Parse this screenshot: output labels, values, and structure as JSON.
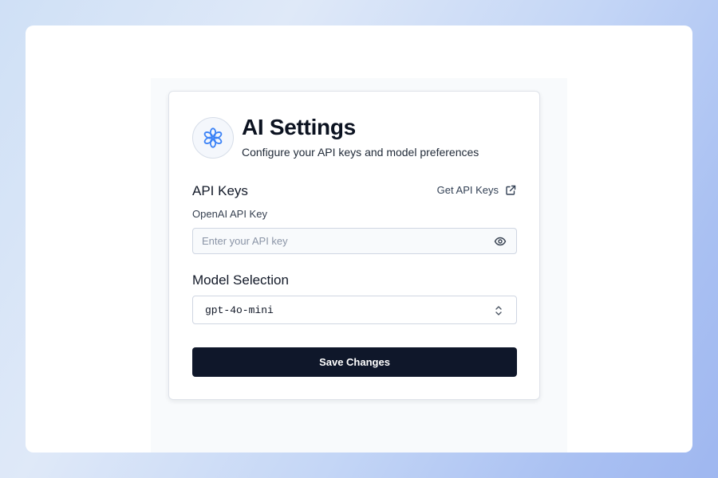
{
  "header": {
    "title": "AI Settings",
    "subtitle": "Configure your API keys and model preferences",
    "icon": "sparkle-flower-icon"
  },
  "api_keys": {
    "section_title": "API Keys",
    "link_label": "Get API Keys",
    "link_icon": "external-link-icon",
    "field_label": "OpenAI API Key",
    "placeholder": "Enter your API key",
    "value": "",
    "toggle_icon": "eye-icon"
  },
  "model": {
    "section_title": "Model Selection",
    "selected": "gpt-4o-mini",
    "chevron_icon": "chevron-up-down-icon"
  },
  "actions": {
    "save_label": "Save Changes"
  },
  "colors": {
    "accent": "#3b82f6",
    "primary_button": "#0f172a",
    "card_border": "#dfe3ea"
  }
}
